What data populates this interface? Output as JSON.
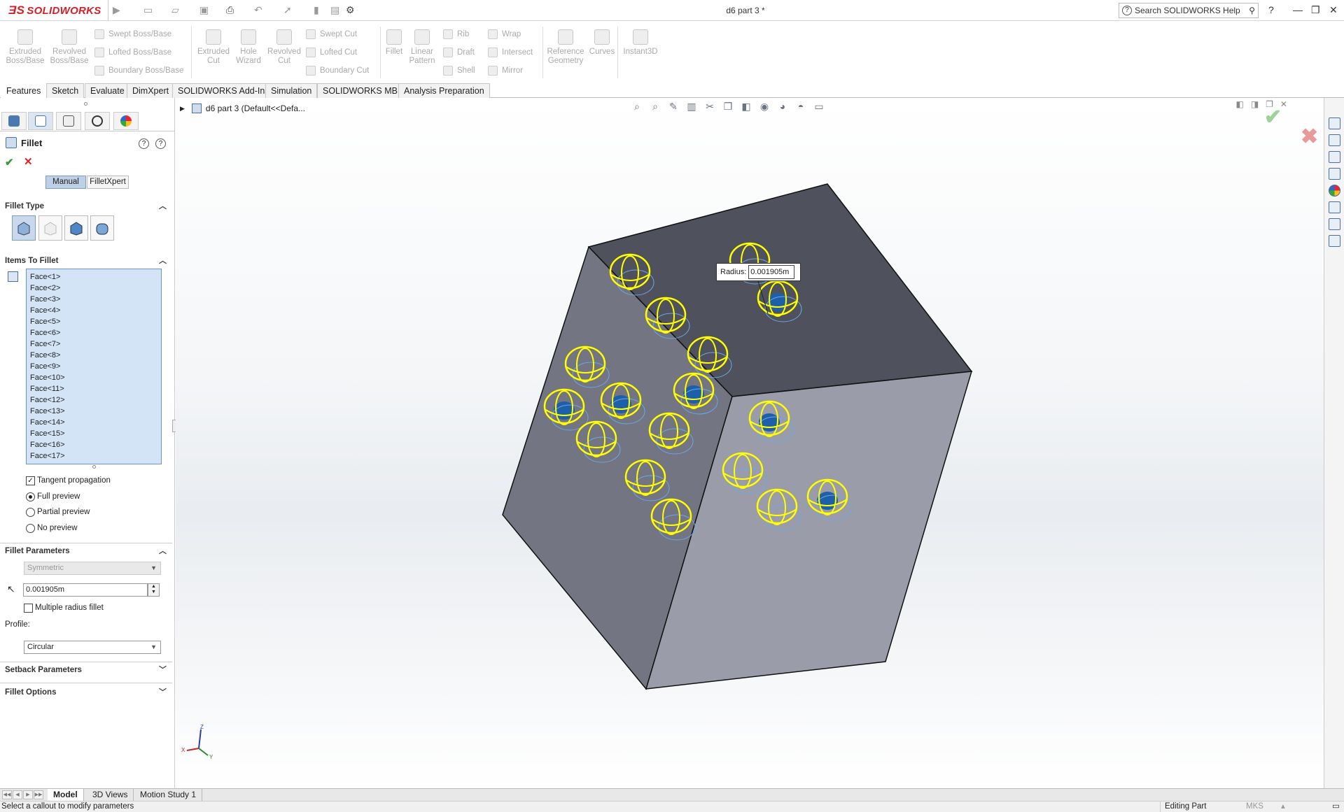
{
  "titlebar": {
    "app_name": "SOLIDWORKS",
    "document_title": "d6 part 3 *",
    "search_placeholder": "Search SOLIDWORKS Help"
  },
  "command_manager": {
    "extruded_boss": "Extruded Boss/Base",
    "revolved_boss": "Revolved Boss/Base",
    "swept_boss": "Swept Boss/Base",
    "lofted_boss": "Lofted Boss/Base",
    "boundary_boss": "Boundary Boss/Base",
    "extruded_cut": "Extruded Cut",
    "hole_wizard": "Hole Wizard",
    "revolved_cut": "Revolved Cut",
    "swept_cut": "Swept Cut",
    "lofted_cut": "Lofted Cut",
    "boundary_cut": "Boundary Cut",
    "fillet": "Fillet",
    "linear_pattern": "Linear Pattern",
    "rib": "Rib",
    "draft": "Draft",
    "shell": "Shell",
    "wrap": "Wrap",
    "intersect": "Intersect",
    "mirror": "Mirror",
    "reference_geometry": "Reference Geometry",
    "curves": "Curves",
    "instant3d": "Instant3D"
  },
  "tabs": [
    "Features",
    "Sketch",
    "Evaluate",
    "DimXpert",
    "SOLIDWORKS Add-Ins",
    "Simulation",
    "SOLIDWORKS MBD",
    "Analysis Preparation"
  ],
  "property_manager": {
    "title": "Fillet",
    "mode_manual": "Manual",
    "mode_xpert": "FilletXpert",
    "fillet_type_header": "Fillet Type",
    "items_header": "Items To Fillet",
    "faces": [
      "Face<1>",
      "Face<2>",
      "Face<3>",
      "Face<4>",
      "Face<5>",
      "Face<6>",
      "Face<7>",
      "Face<8>",
      "Face<9>",
      "Face<10>",
      "Face<11>",
      "Face<12>",
      "Face<13>",
      "Face<14>",
      "Face<15>",
      "Face<16>",
      "Face<17>"
    ],
    "tangent_propagation": "Tangent propagation",
    "full_preview": "Full preview",
    "partial_preview": "Partial preview",
    "no_preview": "No preview",
    "params_header": "Fillet Parameters",
    "symmetric": "Symmetric",
    "radius_value": "0.001905m",
    "multiple_radius": "Multiple radius fillet",
    "profile_label": "Profile:",
    "profile_value": "Circular",
    "setback_header": "Setback Parameters",
    "options_header": "Fillet Options"
  },
  "viewport": {
    "tree_root": "d6 part 3  (Default<<Defa...",
    "callout_label": "Radius:",
    "callout_value": "0.001905m",
    "triad_x": "X",
    "triad_y": "Y",
    "triad_z": "Z"
  },
  "bottom_tabs": [
    "Model",
    "3D Views",
    "Motion Study 1"
  ],
  "status": {
    "message": "Select a callout to modify parameters",
    "mode": "Editing Part",
    "units": "MKS"
  },
  "colors": {
    "brand_red": "#d32027",
    "selection_yellow": "#ffff00",
    "list_bg": "#d3e4f7"
  }
}
